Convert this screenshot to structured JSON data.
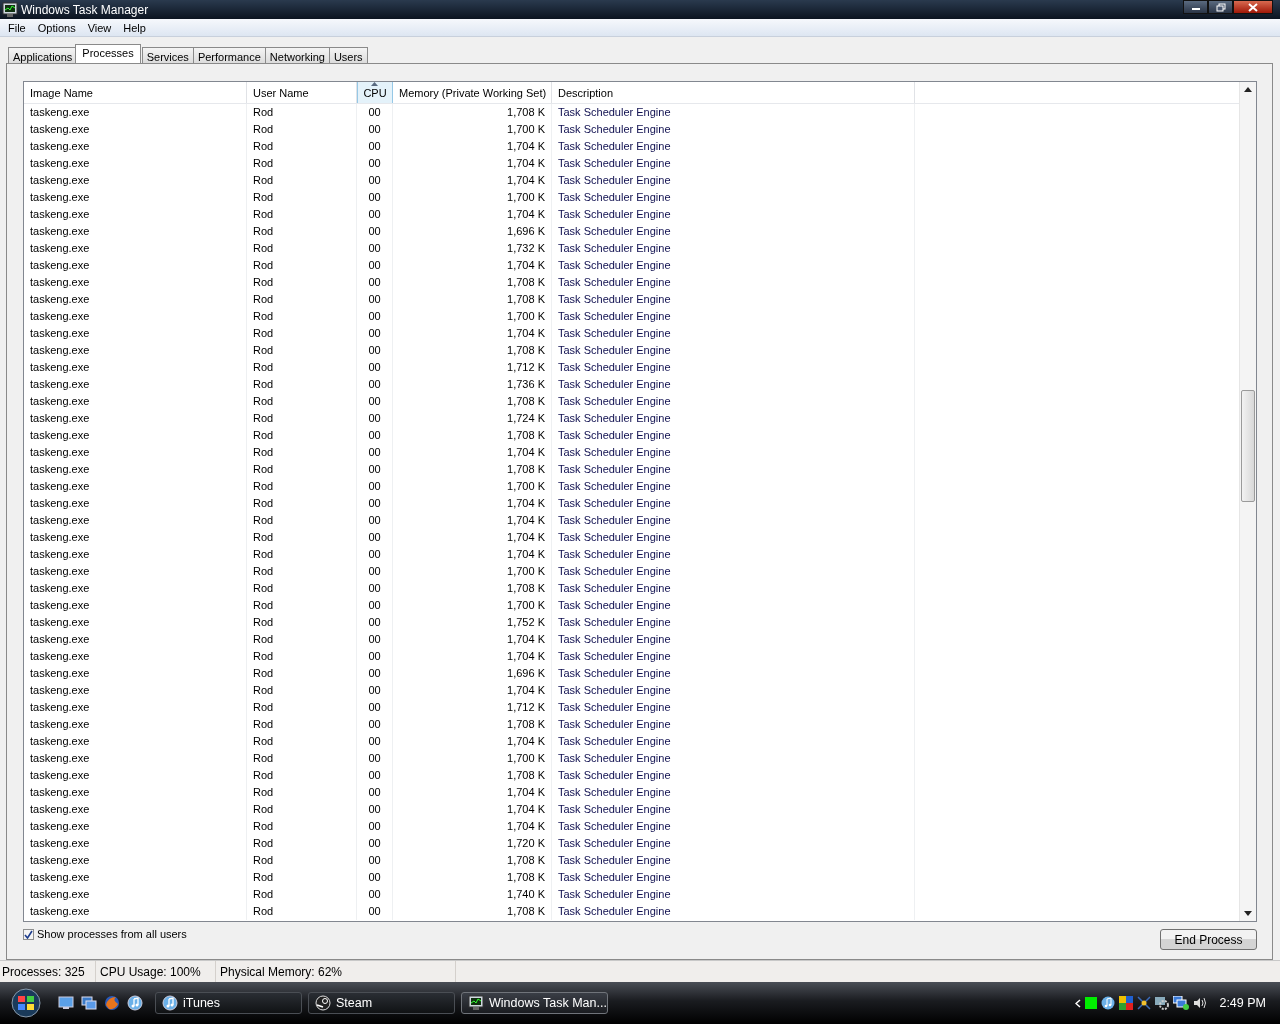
{
  "window": {
    "title": "Windows Task Manager"
  },
  "menu": [
    "File",
    "Options",
    "View",
    "Help"
  ],
  "tabs": [
    {
      "label": "Applications",
      "selected": false
    },
    {
      "label": "Processes",
      "selected": true
    },
    {
      "label": "Services",
      "selected": false
    },
    {
      "label": "Performance",
      "selected": false
    },
    {
      "label": "Networking",
      "selected": false
    },
    {
      "label": "Users",
      "selected": false
    }
  ],
  "table": {
    "columns": [
      {
        "label": "Image Name",
        "sorted": false
      },
      {
        "label": "User Name",
        "sorted": false
      },
      {
        "label": "CPU",
        "sorted": true
      },
      {
        "label": "Memory (Private Working Set)",
        "sorted": false
      },
      {
        "label": "Description",
        "sorted": false
      }
    ],
    "rows": [
      [
        "taskeng.exe",
        "Rod",
        "00",
        "1,708 K",
        "Task Scheduler Engine"
      ],
      [
        "taskeng.exe",
        "Rod",
        "00",
        "1,700 K",
        "Task Scheduler Engine"
      ],
      [
        "taskeng.exe",
        "Rod",
        "00",
        "1,704 K",
        "Task Scheduler Engine"
      ],
      [
        "taskeng.exe",
        "Rod",
        "00",
        "1,704 K",
        "Task Scheduler Engine"
      ],
      [
        "taskeng.exe",
        "Rod",
        "00",
        "1,704 K",
        "Task Scheduler Engine"
      ],
      [
        "taskeng.exe",
        "Rod",
        "00",
        "1,700 K",
        "Task Scheduler Engine"
      ],
      [
        "taskeng.exe",
        "Rod",
        "00",
        "1,704 K",
        "Task Scheduler Engine"
      ],
      [
        "taskeng.exe",
        "Rod",
        "00",
        "1,696 K",
        "Task Scheduler Engine"
      ],
      [
        "taskeng.exe",
        "Rod",
        "00",
        "1,732 K",
        "Task Scheduler Engine"
      ],
      [
        "taskeng.exe",
        "Rod",
        "00",
        "1,704 K",
        "Task Scheduler Engine"
      ],
      [
        "taskeng.exe",
        "Rod",
        "00",
        "1,708 K",
        "Task Scheduler Engine"
      ],
      [
        "taskeng.exe",
        "Rod",
        "00",
        "1,708 K",
        "Task Scheduler Engine"
      ],
      [
        "taskeng.exe",
        "Rod",
        "00",
        "1,700 K",
        "Task Scheduler Engine"
      ],
      [
        "taskeng.exe",
        "Rod",
        "00",
        "1,704 K",
        "Task Scheduler Engine"
      ],
      [
        "taskeng.exe",
        "Rod",
        "00",
        "1,708 K",
        "Task Scheduler Engine"
      ],
      [
        "taskeng.exe",
        "Rod",
        "00",
        "1,712 K",
        "Task Scheduler Engine"
      ],
      [
        "taskeng.exe",
        "Rod",
        "00",
        "1,736 K",
        "Task Scheduler Engine"
      ],
      [
        "taskeng.exe",
        "Rod",
        "00",
        "1,708 K",
        "Task Scheduler Engine"
      ],
      [
        "taskeng.exe",
        "Rod",
        "00",
        "1,724 K",
        "Task Scheduler Engine"
      ],
      [
        "taskeng.exe",
        "Rod",
        "00",
        "1,708 K",
        "Task Scheduler Engine"
      ],
      [
        "taskeng.exe",
        "Rod",
        "00",
        "1,704 K",
        "Task Scheduler Engine"
      ],
      [
        "taskeng.exe",
        "Rod",
        "00",
        "1,708 K",
        "Task Scheduler Engine"
      ],
      [
        "taskeng.exe",
        "Rod",
        "00",
        "1,700 K",
        "Task Scheduler Engine"
      ],
      [
        "taskeng.exe",
        "Rod",
        "00",
        "1,704 K",
        "Task Scheduler Engine"
      ],
      [
        "taskeng.exe",
        "Rod",
        "00",
        "1,704 K",
        "Task Scheduler Engine"
      ],
      [
        "taskeng.exe",
        "Rod",
        "00",
        "1,704 K",
        "Task Scheduler Engine"
      ],
      [
        "taskeng.exe",
        "Rod",
        "00",
        "1,704 K",
        "Task Scheduler Engine"
      ],
      [
        "taskeng.exe",
        "Rod",
        "00",
        "1,700 K",
        "Task Scheduler Engine"
      ],
      [
        "taskeng.exe",
        "Rod",
        "00",
        "1,708 K",
        "Task Scheduler Engine"
      ],
      [
        "taskeng.exe",
        "Rod",
        "00",
        "1,700 K",
        "Task Scheduler Engine"
      ],
      [
        "taskeng.exe",
        "Rod",
        "00",
        "1,752 K",
        "Task Scheduler Engine"
      ],
      [
        "taskeng.exe",
        "Rod",
        "00",
        "1,704 K",
        "Task Scheduler Engine"
      ],
      [
        "taskeng.exe",
        "Rod",
        "00",
        "1,704 K",
        "Task Scheduler Engine"
      ],
      [
        "taskeng.exe",
        "Rod",
        "00",
        "1,696 K",
        "Task Scheduler Engine"
      ],
      [
        "taskeng.exe",
        "Rod",
        "00",
        "1,704 K",
        "Task Scheduler Engine"
      ],
      [
        "taskeng.exe",
        "Rod",
        "00",
        "1,712 K",
        "Task Scheduler Engine"
      ],
      [
        "taskeng.exe",
        "Rod",
        "00",
        "1,708 K",
        "Task Scheduler Engine"
      ],
      [
        "taskeng.exe",
        "Rod",
        "00",
        "1,704 K",
        "Task Scheduler Engine"
      ],
      [
        "taskeng.exe",
        "Rod",
        "00",
        "1,700 K",
        "Task Scheduler Engine"
      ],
      [
        "taskeng.exe",
        "Rod",
        "00",
        "1,708 K",
        "Task Scheduler Engine"
      ],
      [
        "taskeng.exe",
        "Rod",
        "00",
        "1,704 K",
        "Task Scheduler Engine"
      ],
      [
        "taskeng.exe",
        "Rod",
        "00",
        "1,704 K",
        "Task Scheduler Engine"
      ],
      [
        "taskeng.exe",
        "Rod",
        "00",
        "1,704 K",
        "Task Scheduler Engine"
      ],
      [
        "taskeng.exe",
        "Rod",
        "00",
        "1,720 K",
        "Task Scheduler Engine"
      ],
      [
        "taskeng.exe",
        "Rod",
        "00",
        "1,708 K",
        "Task Scheduler Engine"
      ],
      [
        "taskeng.exe",
        "Rod",
        "00",
        "1,708 K",
        "Task Scheduler Engine"
      ],
      [
        "taskeng.exe",
        "Rod",
        "00",
        "1,740 K",
        "Task Scheduler Engine"
      ],
      [
        "taskeng.exe",
        "Rod",
        "00",
        "1,708 K",
        "Task Scheduler Engine"
      ]
    ]
  },
  "show_all_users": {
    "label": "Show processes from all users",
    "checked": true
  },
  "end_process_button": "End Process",
  "status_bar": [
    "Processes: 325",
    "CPU Usage: 100%",
    "Physical Memory: 62%"
  ],
  "taskbar": {
    "tasks": [
      {
        "label": "iTunes",
        "selected": false
      },
      {
        "label": "Steam",
        "selected": false
      },
      {
        "label": "Windows Task Man...",
        "selected": true
      }
    ],
    "clock": "2:49 PM"
  }
}
